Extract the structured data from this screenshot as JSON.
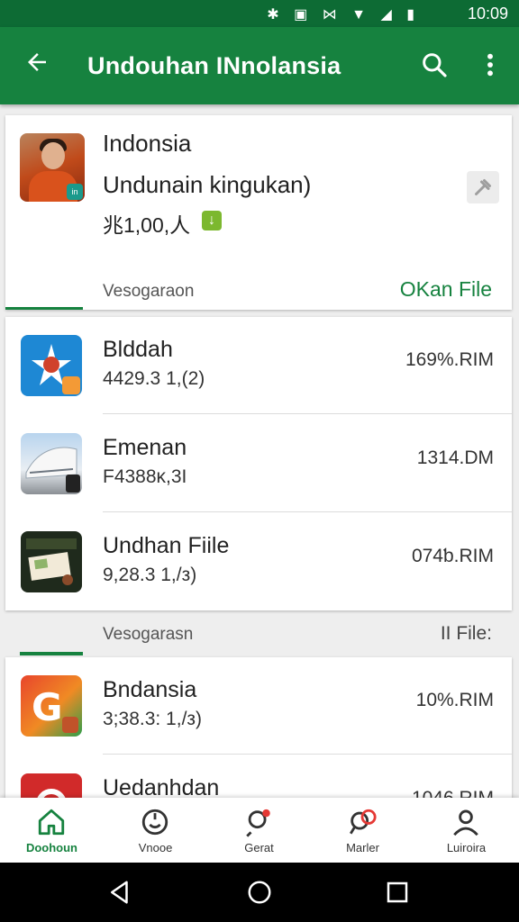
{
  "status_bar": {
    "time": "10:09",
    "icons": [
      "bluetooth-icon",
      "vibrate-icon",
      "nfc-icon",
      "wifi-icon",
      "signal-icon",
      "battery-icon"
    ]
  },
  "app_bar": {
    "title": "Undouhan INnolansia"
  },
  "featured": {
    "name": "Indonsia",
    "subtitle": "Undunain kingukan)",
    "price": "兆1,00,人",
    "footer_left": "Vesogaraon",
    "footer_right": "OKan File"
  },
  "list_primary": [
    {
      "name": "Blddah",
      "meta": "4429.3 1,(2)",
      "size": "169%.RIM",
      "icon": "flower-emblem-icon"
    },
    {
      "name": "Emenan",
      "meta": "F4388ĸ,3I",
      "size": "1314.DM",
      "icon": "stadium-icon"
    },
    {
      "name": "Undhan Fiile",
      "meta": "9,28.3 1,/з)",
      "size": "074ƅ.RIM",
      "icon": "book-icon"
    }
  ],
  "section": {
    "left_label": "Vesogarasn",
    "right_label": "II File:"
  },
  "list_secondary": [
    {
      "name": "Bndansia",
      "meta": "3;38.3: 1,/з)",
      "size": "10%.RIM",
      "icon": "g-logo-icon"
    },
    {
      "name": "Uedanhdan",
      "meta": "",
      "size": "1046.RIM",
      "icon": "red-circle-icon"
    }
  ],
  "bottom_nav": [
    {
      "label": "Doohoun",
      "icon": "home-icon",
      "active": true
    },
    {
      "label": "Vnooe",
      "icon": "face-icon",
      "active": false
    },
    {
      "label": "Gerat",
      "icon": "search-person-icon",
      "active": false
    },
    {
      "label": "Marler",
      "icon": "chat-bubble-icon",
      "active": false
    },
    {
      "label": "Luiroira",
      "icon": "person-icon",
      "active": false
    }
  ],
  "colors": {
    "primary": "#16823f",
    "primary_dark": "#0d6b34",
    "background": "#eeeeee"
  }
}
